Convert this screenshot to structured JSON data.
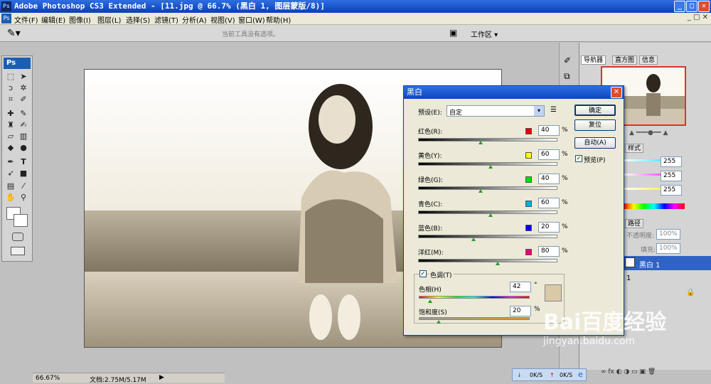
{
  "titlebar": {
    "app_icon": "Ps",
    "title": "Adobe Photoshop CS3 Extended - [11.jpg @ 66.7% (黑白 1, 图层蒙版/8)]"
  },
  "menu": [
    "文件(F)",
    "编辑(E)",
    "图像(I)",
    "图层(L)",
    "选择(S)",
    "滤镜(T)",
    "分析(A)",
    "视图(V)",
    "窗口(W)",
    "帮助(H)"
  ],
  "options_bar": {
    "hint": "当前工具没有选项。",
    "workspace": "工作区 ▾"
  },
  "toolbox": {
    "logo": "Ps"
  },
  "statusbar": {
    "zoom": "66.67%",
    "doc": "文档:2.75M/5.17M"
  },
  "panels": {
    "nav_tabs": [
      "导航器",
      "直方图",
      "信息"
    ],
    "style_tab": "样式",
    "color_values": [
      "255",
      "255",
      "255"
    ],
    "layers_tab": "路径",
    "opacity_label": "不透明度:",
    "opacity_value": "100%",
    "fill_label": "填充:",
    "fill_value": "100%",
    "layer_name": "黑白 1",
    "layer_two": "1"
  },
  "dialog": {
    "title": "黑白",
    "preset_label": "预设(E):",
    "preset_value": "自定",
    "buttons": {
      "ok": "确定",
      "reset": "复位",
      "auto": "自动(A)"
    },
    "preview_label": "预览(P)",
    "sliders": [
      {
        "label": "红色(R):",
        "value": "40",
        "color": "#e00000",
        "pos": 0.45
      },
      {
        "label": "黄色(Y):",
        "value": "60",
        "color": "#ffff00",
        "pos": 0.52
      },
      {
        "label": "绿色(G):",
        "value": "40",
        "color": "#00e000",
        "pos": 0.45
      },
      {
        "label": "青色(C):",
        "value": "60",
        "color": "#00aaee",
        "pos": 0.52
      },
      {
        "label": "蓝色(B):",
        "value": "20",
        "color": "#0000e0",
        "pos": 0.4
      },
      {
        "label": "洋红(M):",
        "value": "80",
        "color": "#e0007a",
        "pos": 0.57
      }
    ],
    "unit": "%",
    "tint_label": "色调(T)",
    "hue_label": "色相(H)",
    "hue_value": "42",
    "hue_unit": "°",
    "sat_label": "饱和度(S)",
    "sat_value": "20",
    "sat_unit": "%",
    "tint_color": "#dbc9a6"
  },
  "taskbar": {
    "down": "0K/S",
    "up": "0K/S"
  },
  "watermark": {
    "brand": "Bai百度经验",
    "url": "jingyan.baidu.com"
  }
}
